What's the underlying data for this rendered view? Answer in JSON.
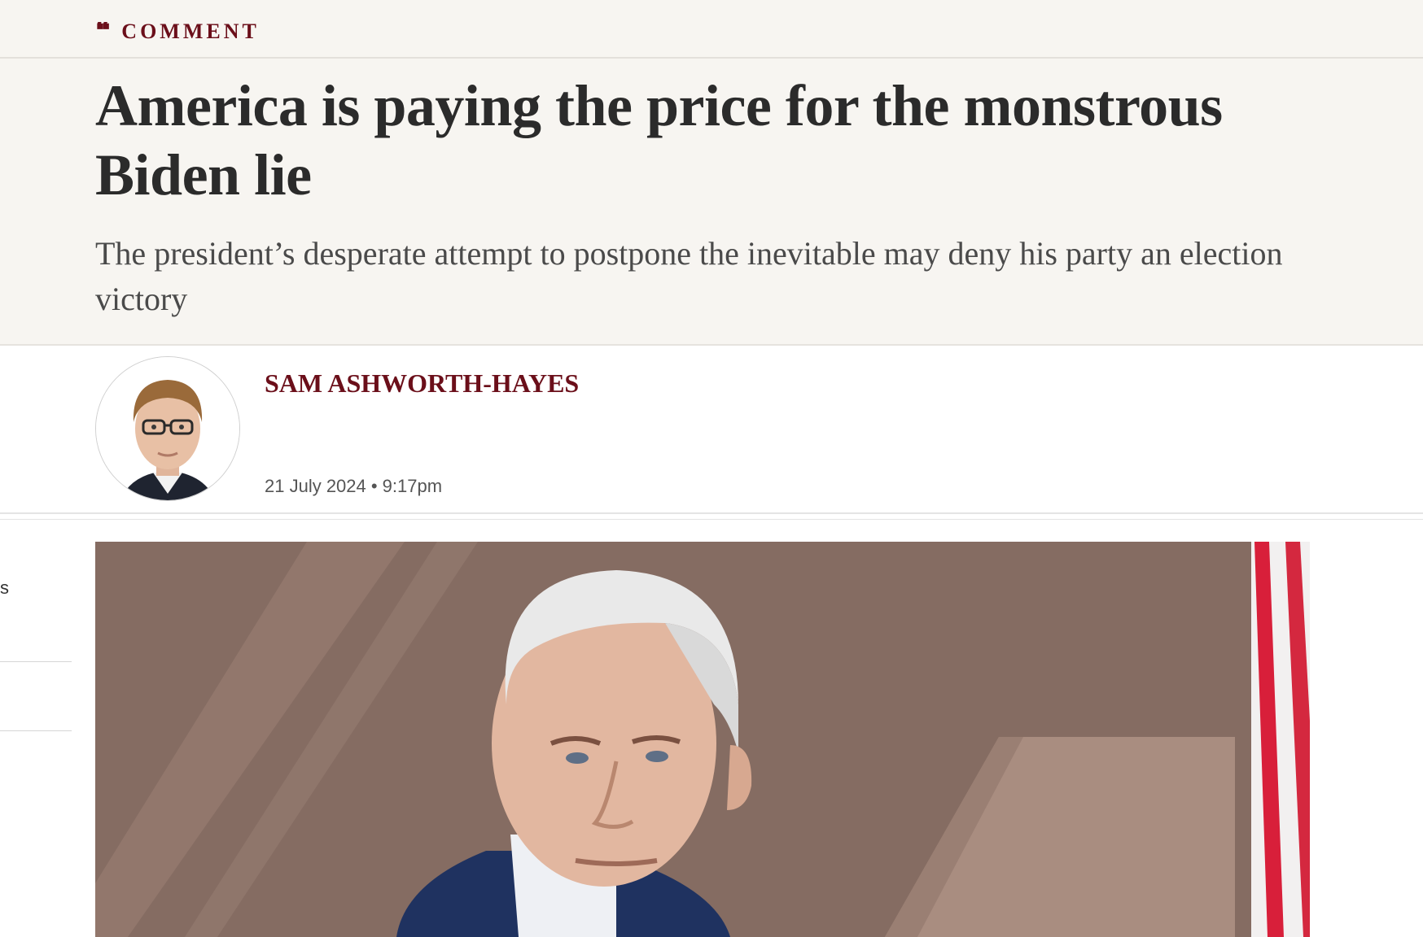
{
  "section": {
    "icon": "quote-icon",
    "icon_glyph": "❝",
    "label": "COMMENT"
  },
  "article": {
    "headline": "America is paying the price for the monstrous Biden lie",
    "standfirst": "The president’s desperate attempt to postpone the inevitable may deny his party an election victory",
    "author": "SAM ASHWORTH-HAYES",
    "dateline": "21 July 2024 • 9:17pm"
  },
  "left_edge": {
    "fragment": "s"
  },
  "colors": {
    "accent": "#6b0f1a",
    "header_background": "#f7f5f1",
    "headline": "#2b2b2b"
  }
}
